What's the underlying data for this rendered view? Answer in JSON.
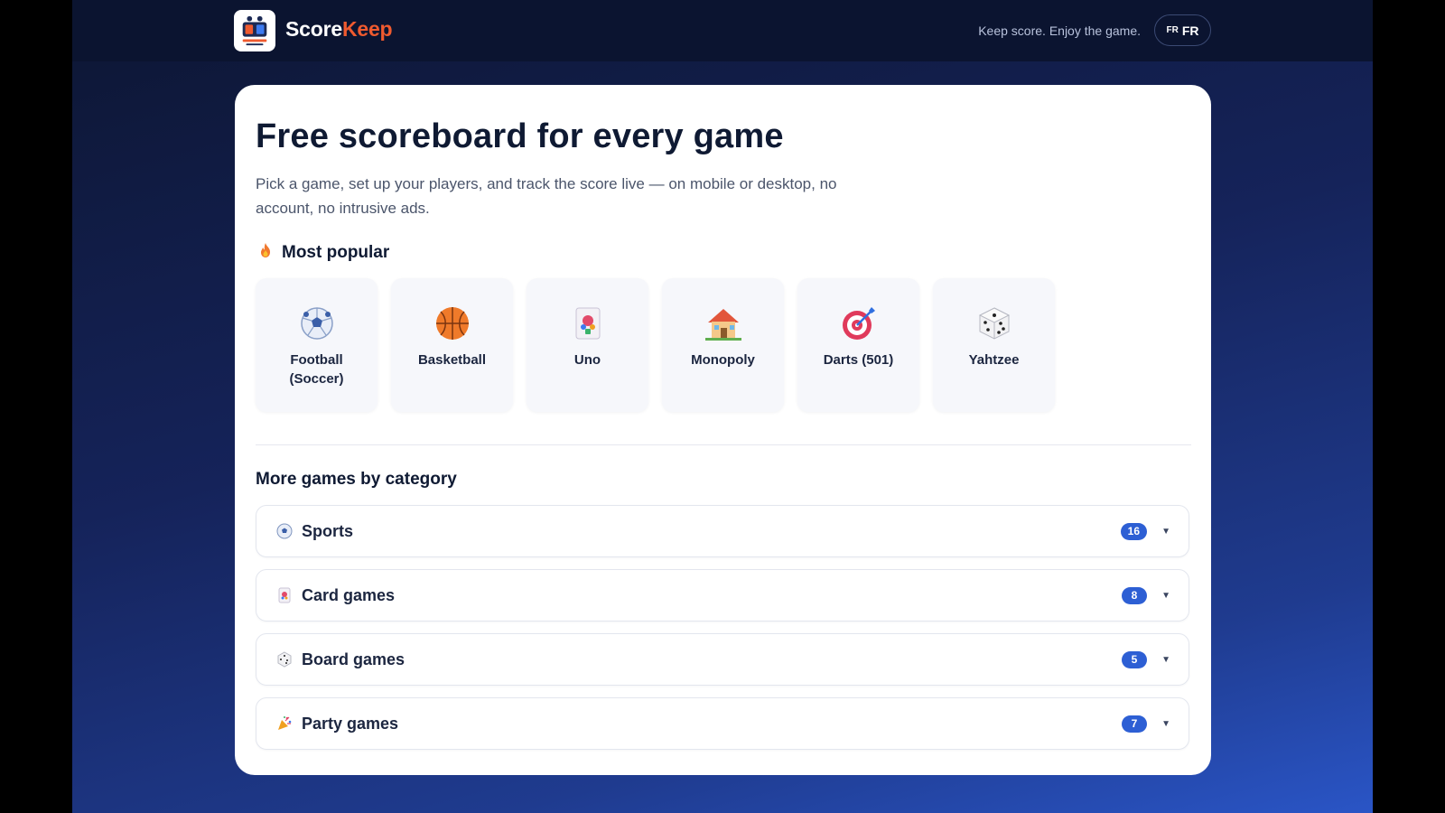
{
  "header": {
    "brand_part1": "Score",
    "brand_part2": "Keep",
    "tagline": "Keep score. Enjoy the game.",
    "lang_flag": "FR",
    "lang_code": "FR"
  },
  "main": {
    "title": "Free scoreboard for every game",
    "subtitle": "Pick a game, set up your players, and track the score live — on mobile or desktop, no account, no intrusive ads.",
    "popular_heading": "Most popular",
    "popular": [
      {
        "name": "Football (Soccer)",
        "icon": "soccer-ball-icon"
      },
      {
        "name": "Basketball",
        "icon": "basketball-icon"
      },
      {
        "name": "Uno",
        "icon": "playing-card-icon"
      },
      {
        "name": "Monopoly",
        "icon": "house-icon"
      },
      {
        "name": "Darts (501)",
        "icon": "dart-target-icon"
      },
      {
        "name": "Yahtzee",
        "icon": "dice-icon"
      }
    ],
    "more_heading": "More games by category",
    "categories": [
      {
        "label": "Sports",
        "count": "16",
        "icon": "soccer-ball-icon"
      },
      {
        "label": "Card games",
        "count": "8",
        "icon": "playing-card-icon"
      },
      {
        "label": "Board games",
        "count": "5",
        "icon": "dice-icon"
      },
      {
        "label": "Party games",
        "count": "7",
        "icon": "party-popper-icon"
      }
    ]
  },
  "colors": {
    "brand_accent": "#ef5a2f",
    "badge": "#2d5fd4",
    "background_dark": "#0b1430"
  }
}
